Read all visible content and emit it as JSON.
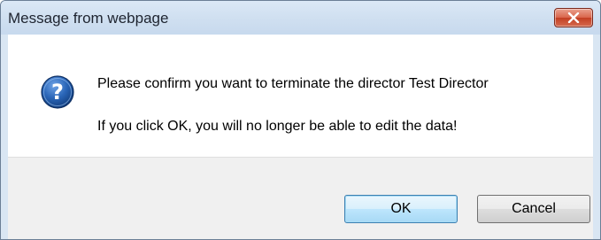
{
  "dialog": {
    "title": "Message from webpage",
    "icon": "question-icon",
    "message_line1": "Please confirm you want to terminate the director Test Director",
    "message_line2": "If you click OK, you will no longer be able to edit the data!",
    "ok_label": "OK",
    "cancel_label": "Cancel",
    "close_icon": "close-icon"
  },
  "colors": {
    "close_button": "#c9482b",
    "question_icon": "#1f5aa8",
    "default_button_border": "#3c7fb1",
    "footer_background": "#f0f0f0",
    "frame_background": "#d9e6f3"
  }
}
